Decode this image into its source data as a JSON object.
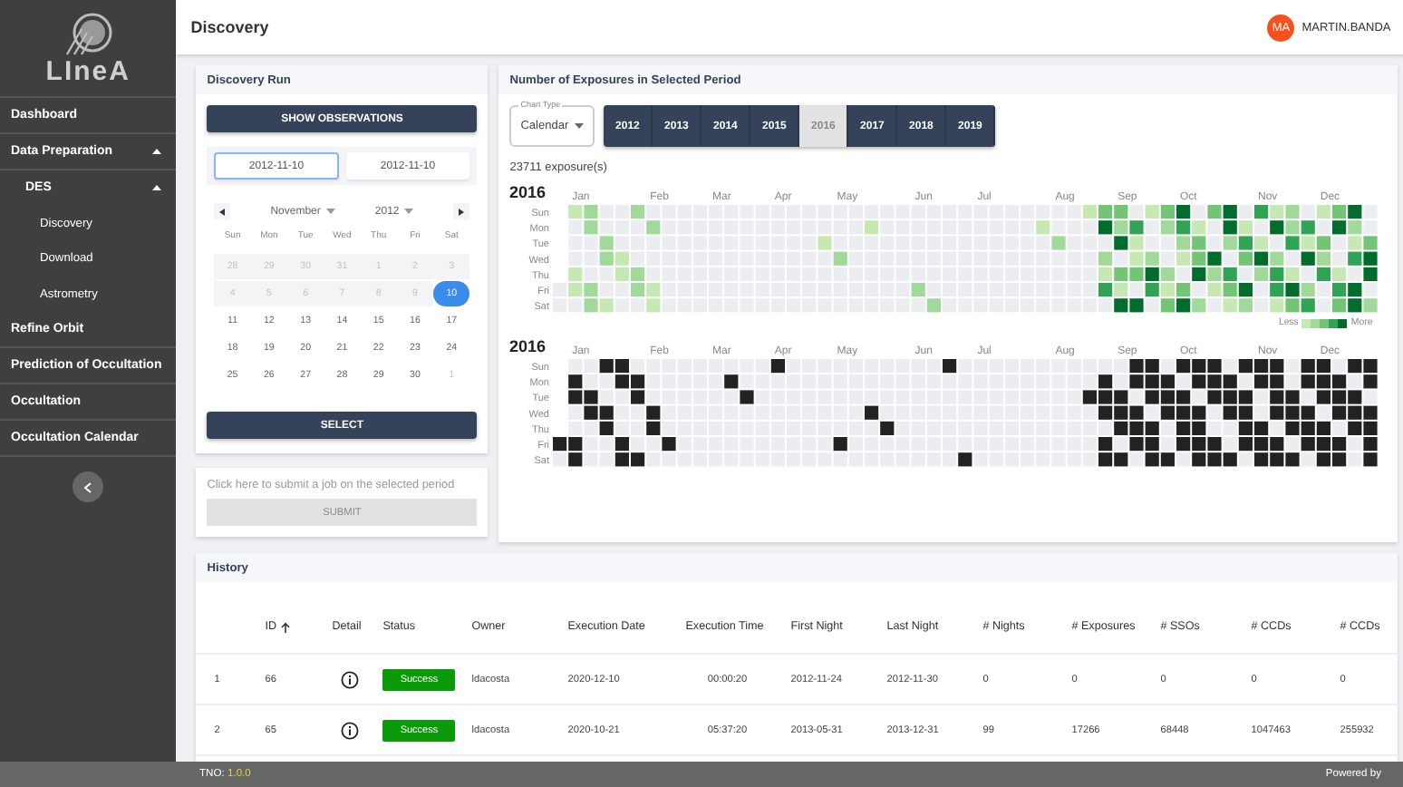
{
  "sidebar": {
    "logo": "LIneA",
    "items": [
      {
        "label": "Dashboard"
      },
      {
        "label": "Data Preparation",
        "expanded": true,
        "children": [
          {
            "label": "DES",
            "expanded": true,
            "children": [
              {
                "label": "Discovery"
              },
              {
                "label": "Download"
              },
              {
                "label": "Astrometry"
              }
            ]
          }
        ]
      },
      {
        "label": "Refine Orbit"
      },
      {
        "label": "Prediction of Occultation"
      },
      {
        "label": "Occultation"
      },
      {
        "label": "Occultation Calendar"
      }
    ]
  },
  "header": {
    "title": "Discovery",
    "user": {
      "initials": "MA",
      "name": "MARTIN.BANDA"
    }
  },
  "discovery_run": {
    "title": "Discovery Run",
    "show_button": "SHOW OBSERVATIONS",
    "date_inputs": [
      {
        "value": "2012-11-10",
        "selected": true
      },
      {
        "value": "2012-11-10",
        "selected": false
      }
    ],
    "calendar": {
      "month": "November",
      "year": "2012",
      "weekdays": [
        "Sun",
        "Mon",
        "Tue",
        "Wed",
        "Thu",
        "Fri",
        "Sat"
      ],
      "days": [
        {
          "label": "28",
          "kind": "disabled",
          "selected": false
        },
        {
          "label": "29",
          "kind": "disabled",
          "selected": false
        },
        {
          "label": "30",
          "kind": "disabled",
          "selected": false
        },
        {
          "label": "31",
          "kind": "disabled",
          "selected": false
        },
        {
          "label": "1",
          "kind": "disabled",
          "selected": false
        },
        {
          "label": "2",
          "kind": "disabled",
          "selected": false
        },
        {
          "label": "3",
          "kind": "disabled",
          "selected": false
        },
        {
          "label": "4",
          "kind": "disabled",
          "selected": false
        },
        {
          "label": "5",
          "kind": "disabled",
          "selected": false
        },
        {
          "label": "6",
          "kind": "disabled",
          "selected": false
        },
        {
          "label": "7",
          "kind": "disabled",
          "selected": false
        },
        {
          "label": "8",
          "kind": "disabled",
          "selected": false
        },
        {
          "label": "9",
          "kind": "disabled",
          "selected": false
        },
        {
          "label": "10",
          "kind": "normal",
          "selected": true
        },
        {
          "label": "11",
          "kind": "normal",
          "selected": false
        },
        {
          "label": "12",
          "kind": "normal",
          "selected": false
        },
        {
          "label": "13",
          "kind": "normal",
          "selected": false
        },
        {
          "label": "14",
          "kind": "normal",
          "selected": false
        },
        {
          "label": "15",
          "kind": "normal",
          "selected": false
        },
        {
          "label": "16",
          "kind": "normal",
          "selected": false
        },
        {
          "label": "17",
          "kind": "normal",
          "selected": false
        },
        {
          "label": "18",
          "kind": "normal",
          "selected": false
        },
        {
          "label": "19",
          "kind": "normal",
          "selected": false
        },
        {
          "label": "20",
          "kind": "normal",
          "selected": false
        },
        {
          "label": "21",
          "kind": "normal",
          "selected": false
        },
        {
          "label": "22",
          "kind": "normal",
          "selected": false
        },
        {
          "label": "23",
          "kind": "normal",
          "selected": false
        },
        {
          "label": "24",
          "kind": "normal",
          "selected": false
        },
        {
          "label": "25",
          "kind": "normal",
          "selected": false
        },
        {
          "label": "26",
          "kind": "normal",
          "selected": false
        },
        {
          "label": "27",
          "kind": "normal",
          "selected": false
        },
        {
          "label": "28",
          "kind": "normal",
          "selected": false
        },
        {
          "label": "29",
          "kind": "normal",
          "selected": false
        },
        {
          "label": "30",
          "kind": "normal",
          "selected": false
        },
        {
          "label": "1",
          "kind": "outside",
          "selected": false
        }
      ]
    },
    "select_button": "SELECT"
  },
  "submit": {
    "hint": "Click here to submit a job on the selected period",
    "button": {
      "label": "SUBMIT",
      "disabled": true
    }
  },
  "exposures": {
    "title": "Number of Exposures in Selected Period",
    "chart_type": {
      "label": "Chart Type",
      "value": "Calendar"
    },
    "years": [
      {
        "label": "2012",
        "selected": false
      },
      {
        "label": "2013",
        "selected": false
      },
      {
        "label": "2014",
        "selected": false
      },
      {
        "label": "2015",
        "selected": false
      },
      {
        "label": "2016",
        "selected": true
      },
      {
        "label": "2017",
        "selected": false
      },
      {
        "label": "2018",
        "selected": false
      },
      {
        "label": "2019",
        "selected": false
      }
    ],
    "count": "23711 exposure(s)",
    "heatmaps": [
      {
        "kind": "graded",
        "year": "2016",
        "months": [
          "Jan",
          "Feb",
          "Mar",
          "Apr",
          "May",
          "Jun",
          "Jul",
          "Aug",
          "Sep",
          "Oct",
          "Nov",
          "Dec"
        ],
        "weekdays": [
          "Sun",
          "Mon",
          "Tue",
          "Wed",
          "Thu",
          "Fri",
          "Sat"
        ],
        "legend": {
          "less": "Less",
          "more": "More"
        }
      },
      {
        "kind": "binary",
        "year": "2016",
        "months": [
          "Jan",
          "Feb",
          "Mar",
          "Apr",
          "May",
          "Jun",
          "Jul",
          "Aug",
          "Sep",
          "Oct",
          "Nov",
          "Dec"
        ],
        "weekdays": [
          "Sun",
          "Mon",
          "Tue",
          "Wed",
          "Thu",
          "Fri",
          "Sat"
        ]
      }
    ]
  },
  "history": {
    "title": "History",
    "columns": [
      {
        "label": "ID",
        "sorted": true
      },
      {
        "label": "Detail",
        "sorted": false
      },
      {
        "label": "Status",
        "sorted": false
      },
      {
        "label": "Owner",
        "sorted": false
      },
      {
        "label": "Execution Date",
        "sorted": false
      },
      {
        "label": "Execution Time",
        "sorted": false
      },
      {
        "label": "First Night",
        "sorted": false
      },
      {
        "label": "Last Night",
        "sorted": false
      },
      {
        "label": "# Nights",
        "sorted": false
      },
      {
        "label": "# Exposures",
        "sorted": false
      },
      {
        "label": "# SSOs",
        "sorted": false
      },
      {
        "label": "# CCDs",
        "sorted": false
      },
      {
        "label": "# CCDs",
        "sorted": false
      }
    ],
    "rows": [
      {
        "index": "1",
        "id": "66",
        "status": "Success",
        "values": [
          "ldacosta",
          "2020-12-10",
          "00:00:20",
          "2012-11-24",
          "2012-11-30",
          "0",
          "0",
          "0",
          "0",
          "0"
        ]
      },
      {
        "index": "2",
        "id": "65",
        "status": "Success",
        "values": [
          "ldacosta",
          "2020-10-21",
          "05:37:20",
          "2013-05-31",
          "2013-12-31",
          "99",
          "17266",
          "68448",
          "1047463",
          "255932"
        ]
      }
    ]
  },
  "footer": {
    "app": "TNO:",
    "version": "1.0.0",
    "powered_by": "Powered by"
  }
}
